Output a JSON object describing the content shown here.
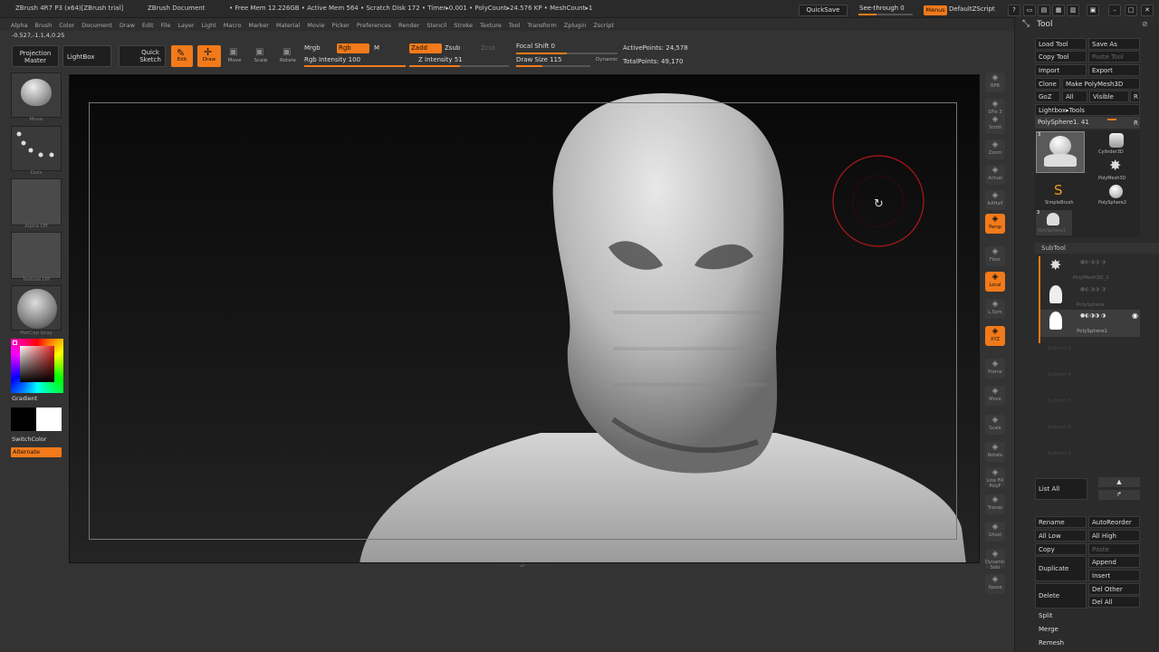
{
  "titlebar": {
    "app": "ZBrush 4R7 P3 (x64)[ZBrush trial]",
    "document": "ZBrush Document",
    "stats": "• Free Mem 12.226GB • Active Mem 564 • Scratch Disk 172 • Timer▸0.001 • PolyCount▸24.576 KP • MeshCount▸1",
    "quicksave": "QuickSave",
    "seethrough": "See-through  0",
    "menus": "Menus",
    "script": "DefaultZScript"
  },
  "menubar": [
    "Alpha",
    "Brush",
    "Color",
    "Document",
    "Draw",
    "Edit",
    "File",
    "Layer",
    "Light",
    "Macro",
    "Marker",
    "Material",
    "Movie",
    "Picker",
    "Preferences",
    "Render",
    "Stencil",
    "Stroke",
    "Texture",
    "Tool",
    "Transform",
    "Zplugin",
    "Zscript"
  ],
  "toolbar": {
    "coords": "-0.527,-1.1,4,0.25",
    "projection_master": "Projection Master",
    "lightbox": "LightBox",
    "quick_sketch": "Quick Sketch",
    "edit": "Edit",
    "draw": "Draw",
    "move": "Move",
    "scale": "Scale",
    "rotate": "Rotate",
    "mrgb": "Mrgb",
    "rgb": "Rgb",
    "m": "M",
    "zadd": "Zadd",
    "zsub": "Zsub",
    "zcut": "Zcut",
    "rgb_intensity": "Rgb Intensity 100",
    "z_intensity": "Z Intensity 51",
    "focal_shift": "Focal Shift 0",
    "draw_size": "Draw Size 115",
    "dynamic": "Dynamic",
    "active_points": "ActivePoints: 24,578",
    "total_points": "TotalPoints: 49,170",
    "rgb_intensity_value": 1.0,
    "z_intensity_value": 0.51,
    "focal_shift_value": 0.5,
    "draw_size_value": 0.35
  },
  "leftshelf": {
    "brush": "Move",
    "stroke": "Dots",
    "alpha": "Alpha Off",
    "texture": "Texture Off",
    "material": "MatCap Gray",
    "gradient": "Gradient",
    "switchcolor": "SwitchColor",
    "alternate": "Alternate"
  },
  "rightshelf": [
    "BPR",
    "SPix 3",
    "Scroll",
    "Zoom",
    "Actual",
    "AAHalf",
    "Persp",
    "Floor",
    "Local",
    "L.Sym",
    "XYZ",
    "Frame",
    "Move",
    "Scale",
    "Rotate",
    "Line Fill PolyF",
    "Transp",
    "Ghost",
    "Dynamic Solo",
    "Xpose"
  ],
  "toolpanel": {
    "title": "Tool",
    "load_tool": "Load Tool",
    "save_as": "Save As",
    "copy_tool": "Copy Tool",
    "paste_tool": "Paste Tool",
    "import": "Import",
    "export": "Export",
    "clone": "Clone",
    "make_polymesh": "Make PolyMesh3D",
    "goz": "GoZ",
    "all": "All",
    "visible": "Visible",
    "r": "R",
    "lightbox_tools": "Lightbox▸Tools",
    "current_tool": "PolySphere1. 41",
    "tools": [
      {
        "name": "PolySphere1",
        "num": "3"
      },
      {
        "name": "Cylinder3D",
        "num": ""
      },
      {
        "name": "PolyMesh3D",
        "num": ""
      },
      {
        "name": "SimpleBrush",
        "num": ""
      },
      {
        "name": "PolySphere2",
        "num": ""
      },
      {
        "name": "PolySphere1",
        "num": "3"
      }
    ],
    "subtool_title": "SubTool",
    "subtools": [
      "PolyMesh3D_1",
      "PolySphere",
      "PolySphere1"
    ],
    "empty_slots": [
      "Subtool 3",
      "Subtool 4",
      "Subtool 5",
      "Subtool 6",
      "Subtool 7"
    ],
    "list_all": "List All",
    "rename": "Rename",
    "autoreorder": "AutoReorder",
    "all_low": "All Low",
    "all_high": "All High",
    "copy": "Copy",
    "paste": "Paste",
    "append": "Append",
    "duplicate": "Duplicate",
    "insert": "Insert",
    "delete": "Delete",
    "del_other": "Del Other",
    "del_all": "Del All",
    "split": "Split",
    "merge": "Merge",
    "remesh": "Remesh"
  },
  "colors": {
    "accent": "#f27a1a",
    "panel": "#2b2b2b",
    "bg": "#333333"
  }
}
